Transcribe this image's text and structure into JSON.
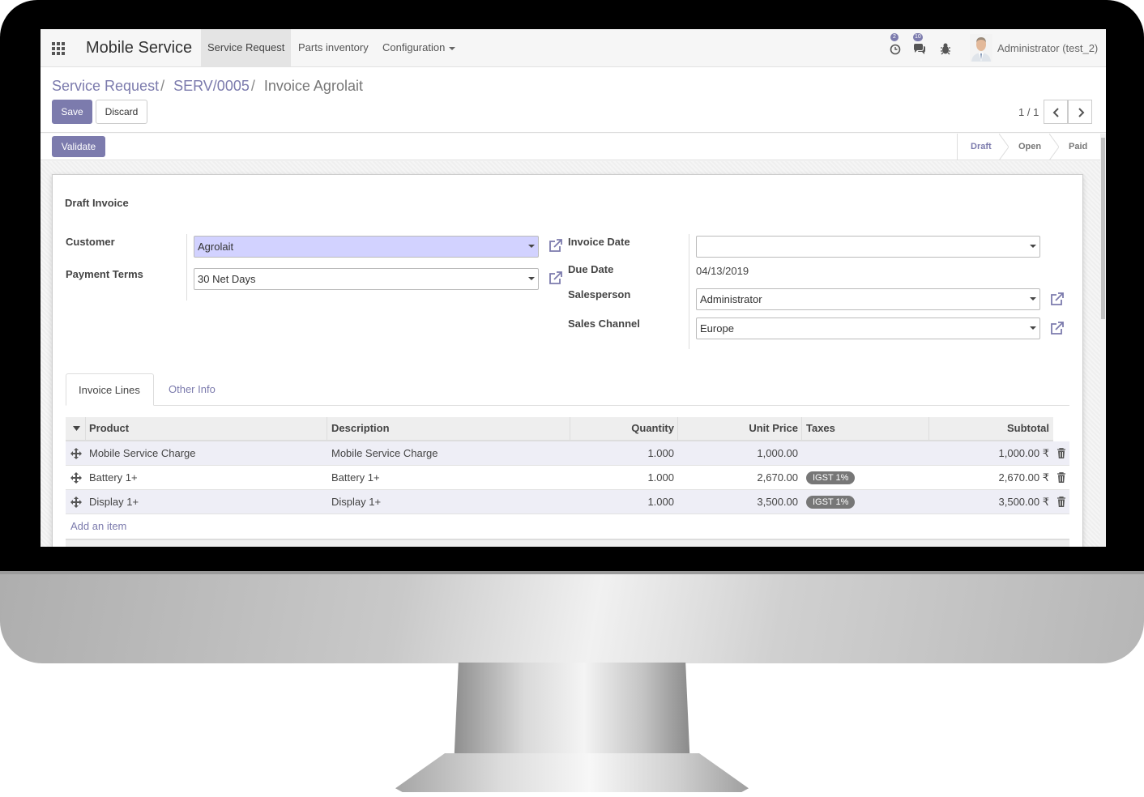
{
  "navbar": {
    "brand": "Mobile Service",
    "menu": [
      "Service Request",
      "Parts inventory",
      "Configuration"
    ],
    "activity_count": "2",
    "message_count": "10",
    "user": "Administrator (test_2)"
  },
  "breadcrumb": {
    "items": [
      "Service Request",
      "SERV/0005"
    ],
    "current": "Invoice Agrolait"
  },
  "buttons": {
    "save": "Save",
    "discard": "Discard",
    "validate": "Validate"
  },
  "pager": {
    "value": "1 / 1"
  },
  "statusbar": {
    "steps": [
      "Draft",
      "Open",
      "Paid"
    ],
    "current": "Draft"
  },
  "form": {
    "title": "Draft Invoice",
    "customer_label": "Customer",
    "customer_value": "Agrolait",
    "payment_terms_label": "Payment Terms",
    "payment_terms_value": "30 Net Days",
    "invoice_date_label": "Invoice Date",
    "invoice_date_value": "",
    "due_date_label": "Due Date",
    "due_date_value": "04/13/2019",
    "salesperson_label": "Salesperson",
    "salesperson_value": "Administrator",
    "sales_channel_label": "Sales Channel",
    "sales_channel_value": "Europe"
  },
  "tabs": [
    "Invoice Lines",
    "Other Info"
  ],
  "lines": {
    "columns": [
      "Product",
      "Description",
      "Quantity",
      "Unit Price",
      "Taxes",
      "Subtotal"
    ],
    "rows": [
      {
        "product": "Mobile Service Charge",
        "description": "Mobile Service Charge",
        "quantity": "1.000",
        "unit_price": "1,000.00",
        "taxes": "",
        "subtotal": "1,000.00 ₹"
      },
      {
        "product": "Battery 1+",
        "description": "Battery 1+",
        "quantity": "1.000",
        "unit_price": "2,670.00",
        "taxes": "IGST 1%",
        "subtotal": "2,670.00 ₹"
      },
      {
        "product": "Display 1+",
        "description": "Display 1+",
        "quantity": "1.000",
        "unit_price": "3,500.00",
        "taxes": "IGST 1%",
        "subtotal": "3,500.00 ₹"
      }
    ],
    "add_item": "Add an item"
  },
  "colors": {
    "primary": "#7c7bad",
    "required_field": "#d2d2ff",
    "badge": "#777777"
  }
}
